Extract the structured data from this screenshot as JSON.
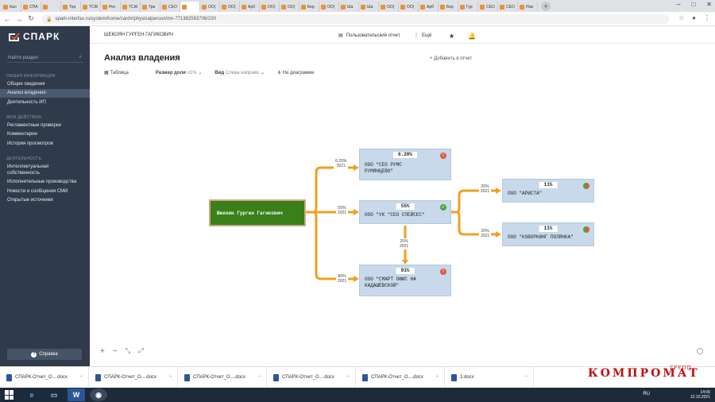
{
  "browser": {
    "tabs": [
      "Кал",
      "СПА",
      "",
      "Тер",
      "ТСЖ",
      "Рес",
      "ТСЖ",
      "Три",
      "СЕО",
      "",
      "ОО(",
      "ОО(",
      "Арб",
      "ОО(",
      "ОО(",
      "Бер",
      "ОО(",
      "Ша",
      "Ша",
      "ОО(",
      "ОО(",
      "Арб",
      "Бер",
      "Гур",
      "СЕО",
      "СЕО",
      "Нов"
    ],
    "url": "spark-interfax.ru/system/home/card#/physicalperson/inn-771382563706/230"
  },
  "sidebar": {
    "logo": "СПАРК",
    "search_placeholder": "Найти раздел",
    "sections": [
      {
        "title": "ОБЩАЯ ИНФОРМАЦИЯ",
        "items": [
          "Общие сведения",
          "Анализ владения",
          "Деятельность ИП"
        ]
      },
      {
        "title": "МОИ ДЕЙСТВИЯ",
        "items": [
          "Регламентные проверки",
          "Комментарии",
          "История просмотров"
        ]
      },
      {
        "title": "ДЕЯТЕЛЬНОСТЬ",
        "items": [
          "Интеллектуальная собственность",
          "Исполнительные производства",
          "Новости и сообщения СМИ",
          "Открытые источники"
        ]
      }
    ],
    "help": "Справка"
  },
  "header": {
    "person": "ШЕКОЯН ГУРГЕН ГАГИКОВИЧ",
    "user_report": "Пользовательский отчет",
    "more": "Ещё"
  },
  "page": {
    "title": "Анализ владения",
    "add_report": "Добавить в отчет",
    "toolbar": {
      "table": "Таблица",
      "size_label": "Размер доли",
      "size_value": "≥1%",
      "view_label": "Вид",
      "view_value": "Слева направо",
      "diagram": "На диаграмме"
    }
  },
  "tree": {
    "root": "Шекоян Гурген Гагикович",
    "nodes": [
      {
        "id": "seo-rums",
        "pct": "6.20%",
        "name": "ООО \"СЕО РУМС РУМЯНЦЕВО\"",
        "status": "red"
      },
      {
        "id": "uk-seo",
        "pct": "55%",
        "name": "ООО \"УК \"СЕО СПЕЙСЕС\"",
        "status": "green"
      },
      {
        "id": "smart",
        "pct": "91%",
        "name": "ООО \"СМАРТ ОФИС НА КАДАШЁВСКОЙ\"",
        "status": "red"
      },
      {
        "id": "arista",
        "pct": "11%",
        "name": "ООО \"АРИСТА\"",
        "status": "mixed"
      },
      {
        "id": "cowork",
        "pct": "11%",
        "name": "ООО \"КОВОРКИНГ ПОЛЯНКА\"",
        "status": "mixed"
      }
    ],
    "edges": [
      {
        "pct": "6.20%",
        "year": "2021"
      },
      {
        "pct": "55%",
        "year": "2021"
      },
      {
        "pct": "80%",
        "year": "2021"
      },
      {
        "pct": "20%",
        "year": "2021"
      },
      {
        "pct": "20%",
        "year": "2021"
      },
      {
        "pct": "20%",
        "year": "2021"
      }
    ],
    "colors": {
      "edge": "#f0a020",
      "root": "#3b7f18",
      "node": "#c7d9ea"
    }
  },
  "downloads": [
    "СПАРК-Отчет_О....docx",
    "СПАРК-Отчет_О....docx",
    "СПАРК-Отчет_О....docx",
    "СПАРК-Отчет_О....docx",
    "СПАРК-Отчет_О....docx",
    "3.docx"
  ],
  "taskbar": {
    "lang": "RU",
    "time": "14:06",
    "date": "12.10.2021"
  },
  "watermark": {
    "main": "КОМПРОМАТ",
    "sub": "ГРУПП"
  }
}
